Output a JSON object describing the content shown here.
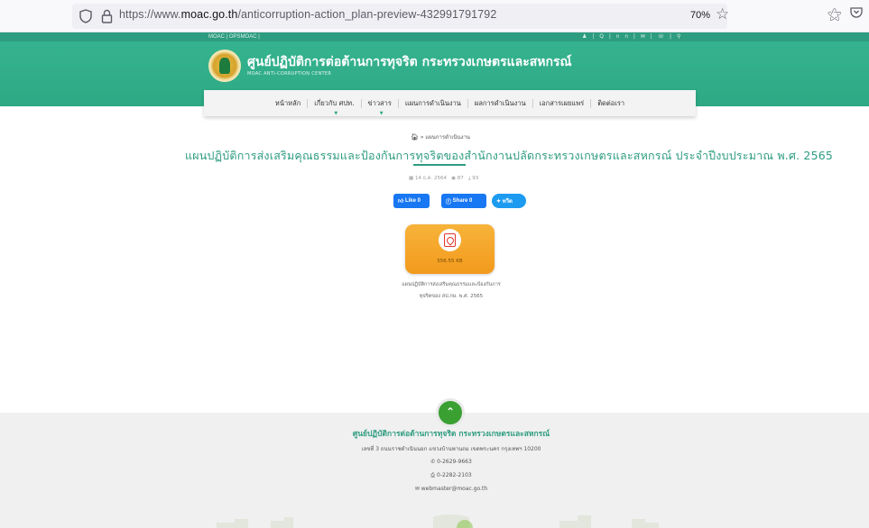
{
  "browser": {
    "url_prefix": "https://www.",
    "url_domain": "moac.go.th",
    "url_path": "/anticorruption-action_plan-preview-432991791792",
    "zoom": "70%"
  },
  "site": {
    "top_links": "MOAC  |  OPSMOAC  |",
    "top_icons": "♟ | Q | ก ก | ✉ | ☏ | ⚲",
    "title": "ศูนย์ปฏิบัติการต่อต้านการทุจริต กระทรวงเกษตรและสหกรณ์",
    "subtitle": "MOAC ANTI-CORRUPTION CENTER"
  },
  "nav": {
    "items": [
      "หน้าหลัก",
      "เกี่ยวกับ ศปท.",
      "ข่าวสาร",
      "แผนการดำเนินงาน",
      "ผลการดำเนินงาน",
      "เอกสารเผยแพร่",
      "ติดต่อเรา"
    ]
  },
  "breadcrumb": {
    "home_icon": "home-icon",
    "separator": "»",
    "current": "แผนการดำเนินงาน"
  },
  "article": {
    "title": "แผนปฏิบัติการส่งเสริมคุณธรรมและป้องกันการทุจริตของสำนักงานปลัดกระทรวงเกษตรและสหกรณ์ ประจำปีงบประมาณ พ.ศ. 2565",
    "date": "14 ธ.ค. 2564",
    "views": "87",
    "downloads": "93"
  },
  "social": {
    "like": "Like 0",
    "share": "Share 0",
    "tweet": "ทวีต"
  },
  "download": {
    "filesize": "556.55 KB",
    "caption_line1": "แผนปฏิบัติการส่งเสริมคุณธรรมและป้องกันการ",
    "caption_line2": "ทุจริตของ สป.กษ. พ.ศ. 2565"
  },
  "footer": {
    "title": "ศูนย์ปฏิบัติการต่อต้านการทุจริต กระทรวงเกษตรและสหกรณ์",
    "address": "เลขที่ 3 ถนนราชดำเนินนอก แขวงบ้านพานถม เขตพระนคร กรุงเทพฯ 10200",
    "phone": "0-2629-9663",
    "fax": "0-2282-2103",
    "email": "webmaster@moac.go.th"
  }
}
